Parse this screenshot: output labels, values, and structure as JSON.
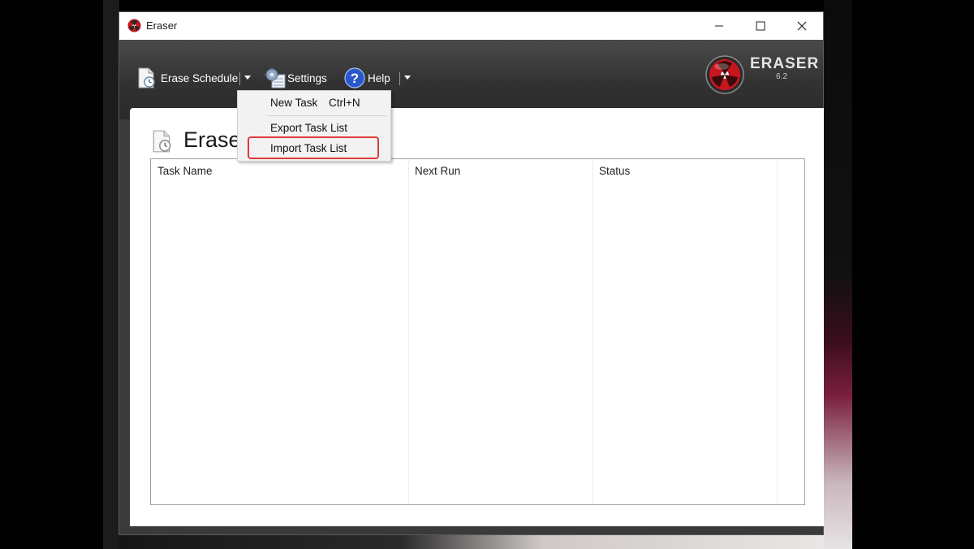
{
  "window": {
    "title": "Eraser"
  },
  "toolbar": {
    "erase_schedule_label": "Erase Schedule",
    "settings_label": "Settings",
    "help_label": "Help"
  },
  "logo": {
    "name": "ERASER",
    "version": "6.2"
  },
  "page": {
    "title": "Erase"
  },
  "table": {
    "columns": [
      "Task Name",
      "Next Run",
      "Status"
    ],
    "rows": []
  },
  "dropdown": {
    "items": [
      {
        "label": "New Task",
        "shortcut": "Ctrl+N"
      },
      {
        "label": "Export Task List",
        "shortcut": ""
      },
      {
        "label": "Import Task List",
        "shortcut": "",
        "highlighted": true
      }
    ]
  },
  "colors": {
    "highlight": "#e03a3a",
    "logo_red": "#c8161e"
  },
  "icons": [
    "eraser-app-icon",
    "erase-schedule-icon",
    "settings-gear-icon",
    "help-question-icon",
    "eraser-logo-icon"
  ]
}
